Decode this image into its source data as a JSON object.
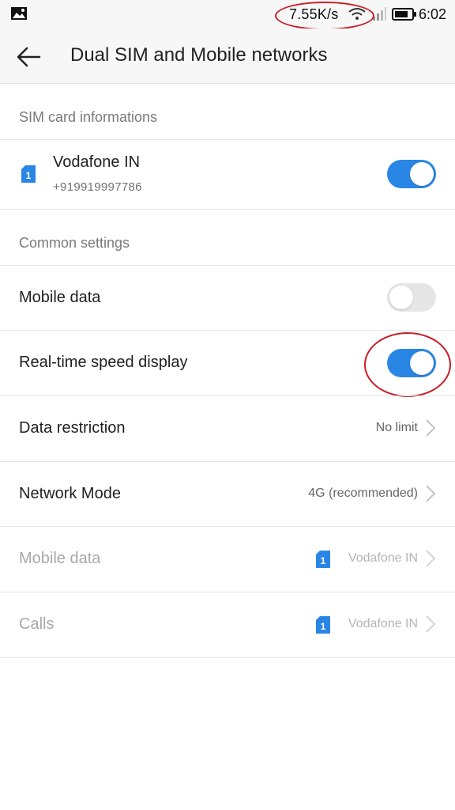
{
  "status_bar": {
    "speed": "7.55K/s",
    "time": "6:02",
    "icons": [
      "gallery-icon",
      "wifi-icon",
      "signal-icon",
      "battery-icon"
    ]
  },
  "app_bar": {
    "title": "Dual SIM and Mobile networks",
    "back_icon": "arrow-left-icon"
  },
  "sim_section": {
    "header": "SIM card informations",
    "sim": {
      "slot": "1",
      "carrier": "Vodafone IN",
      "number": "+919919997786",
      "enabled": true
    }
  },
  "common_section": {
    "header": "Common settings",
    "mobile_data_toggle": {
      "label": "Mobile data",
      "on": false
    },
    "speed_display_toggle": {
      "label": "Real-time speed display",
      "on": true
    },
    "data_restriction": {
      "label": "Data restriction",
      "value": "No limit"
    },
    "network_mode": {
      "label": "Network Mode",
      "value": "4G (recommended)"
    },
    "mobile_data_sim": {
      "label": "Mobile data",
      "sim_slot": "1",
      "value": "Vodafone IN"
    },
    "calls_sim": {
      "label": "Calls",
      "sim_slot": "1",
      "value": "Vodafone IN"
    }
  },
  "colors": {
    "accent": "#2a86e5",
    "annotation": "#c81e28"
  }
}
